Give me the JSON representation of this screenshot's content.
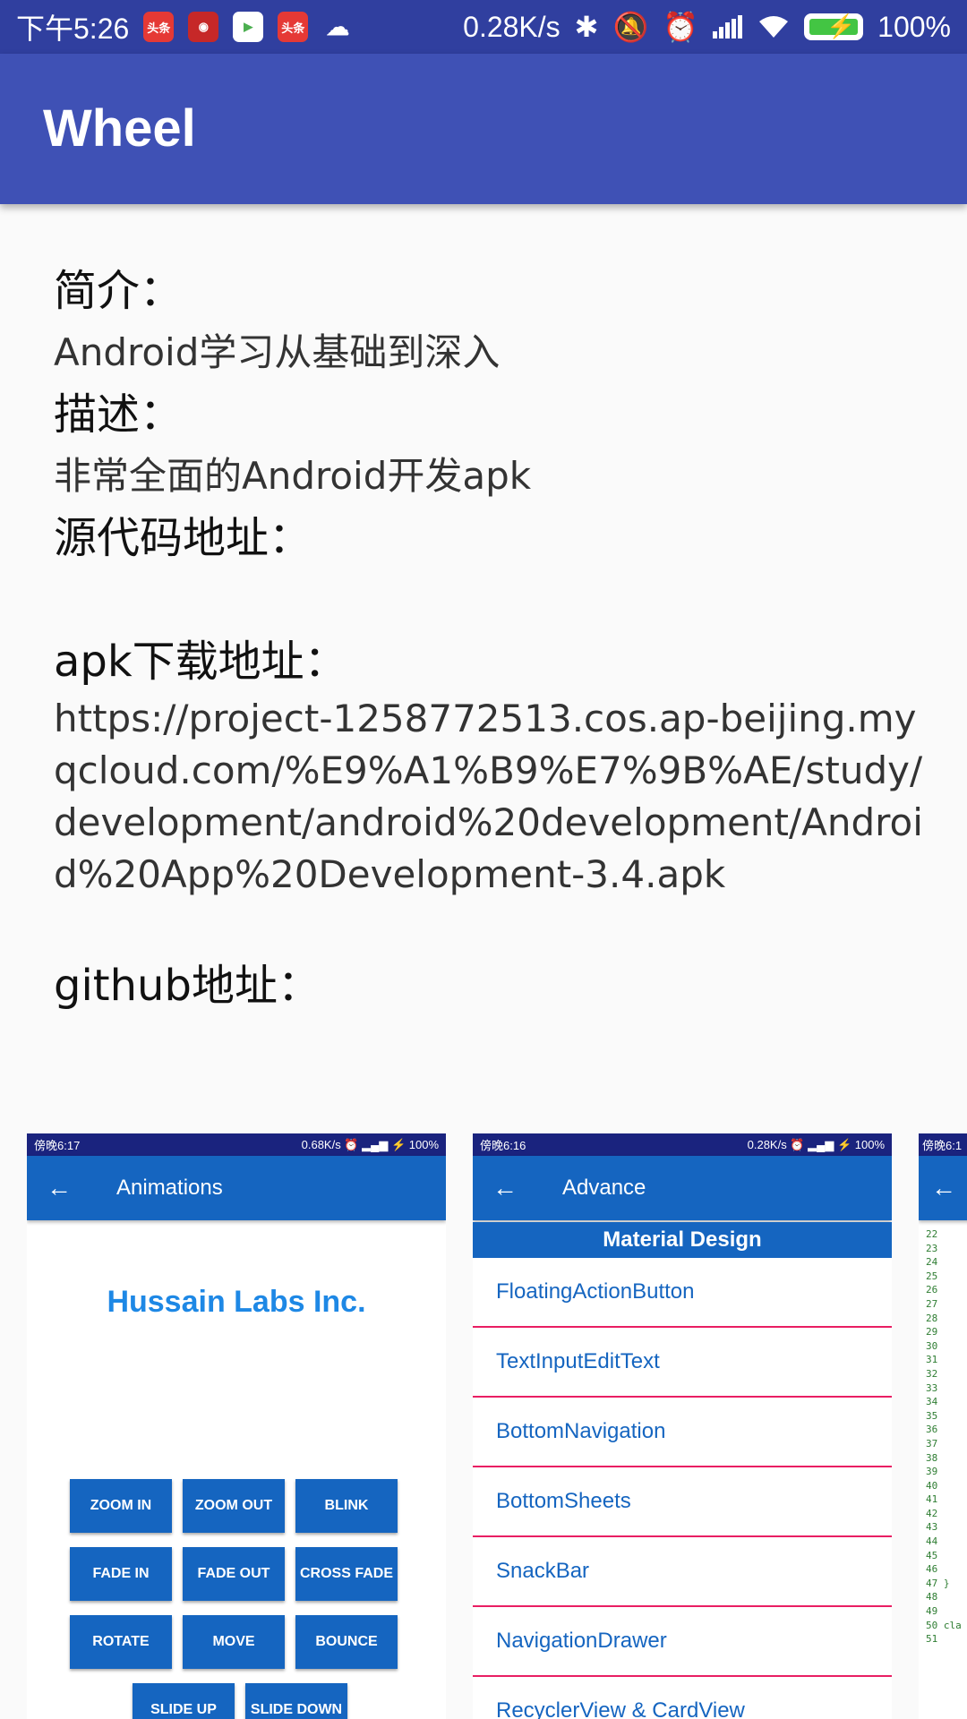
{
  "status_bar": {
    "time": "下午5:26",
    "network_speed": "0.28K/s",
    "battery": "100%",
    "icons": [
      "toutiao-icon",
      "weibo-icon",
      "play-icon",
      "toutiao-icon",
      "cat-icon",
      "bluetooth-icon",
      "mute-icon",
      "alarm-icon",
      "signal-icon",
      "wifi-icon",
      "battery-icon"
    ],
    "app_badges": [
      "头条",
      "头条"
    ]
  },
  "app_bar": {
    "title": "Wheel"
  },
  "content": {
    "intro_label": "简介：",
    "intro_text": "Android学习从基础到深入",
    "desc_label": "描述：",
    "desc_text": "非常全面的Android开发apk",
    "source_label": "源代码地址：",
    "apk_label": "apk下载地址：",
    "apk_url": "https://project-1258772513.cos.ap-beijing.myqcloud.com/%E9%A1%B9%E7%9B%AE/study/development/android%20development/Android%20App%20Development-3.4.apk",
    "github_label": "github地址："
  },
  "screenshots": {
    "shot1": {
      "time": "傍晚6:17",
      "speed": "0.68K/s",
      "battery": "100%",
      "title": "Animations",
      "brand": "Hussain Labs Inc.",
      "buttons": [
        [
          "ZOOM IN",
          "ZOOM OUT",
          "BLINK"
        ],
        [
          "FADE IN",
          "FADE OUT",
          "CROSS FADE"
        ],
        [
          "ROTATE",
          "MOVE",
          "BOUNCE"
        ],
        [
          "SLIDE UP",
          "SLIDE DOWN"
        ]
      ]
    },
    "shot2": {
      "time": "傍晚6:16",
      "speed": "0.28K/s",
      "battery": "100%",
      "title": "Advance",
      "section": "Material Design",
      "items": [
        "FloatingActionButton",
        "TextInputEditText",
        "BottomNavigation",
        "BottomSheets",
        "SnackBar",
        "NavigationDrawer",
        "RecyclerView & CardView"
      ]
    },
    "shot3": {
      "time": "傍晚6:1",
      "line_numbers": "22\n23\n24\n25\n26\n27\n28\n29\n30\n31\n32\n33\n34\n35\n36\n37\n38\n39\n40\n41\n42\n43\n44\n45\n46\n47 }\n48\n49\n50 cla\n51"
    }
  },
  "colors": {
    "status_bar": "#303f9f",
    "app_bar": "#3f51b5",
    "shot_accent": "#1565c0",
    "divider": "#e91e63"
  }
}
